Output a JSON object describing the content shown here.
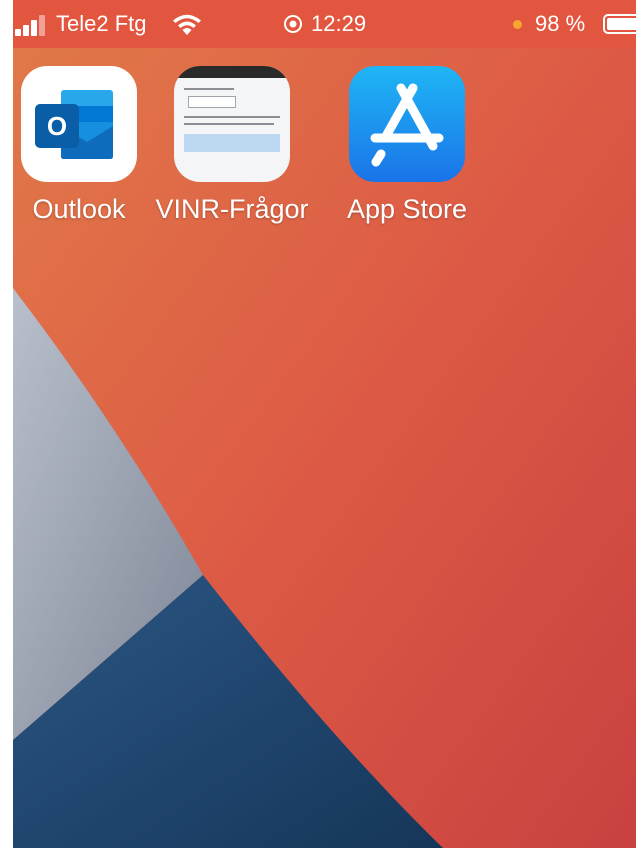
{
  "status_bar": {
    "carrier": "Tele2 Ftg",
    "time": "12:29",
    "battery_percent": "98 %",
    "battery_level": 0.98,
    "icons": [
      "signal-icon",
      "wifi-icon",
      "location-icon",
      "battery-icon"
    ],
    "battery_dot_color": "#f7a531"
  },
  "apps": [
    {
      "label": "Outlook",
      "icon": "outlook-icon"
    },
    {
      "label": "VINR-Frågor",
      "icon": "vinr-fragor-icon"
    },
    {
      "label": "App Store",
      "icon": "app-store-icon"
    }
  ],
  "colors": {
    "status_bar_bg": "#e2563f",
    "outlook_blue": "#0f6cbd",
    "app_store_blue": "#1a74e8"
  }
}
